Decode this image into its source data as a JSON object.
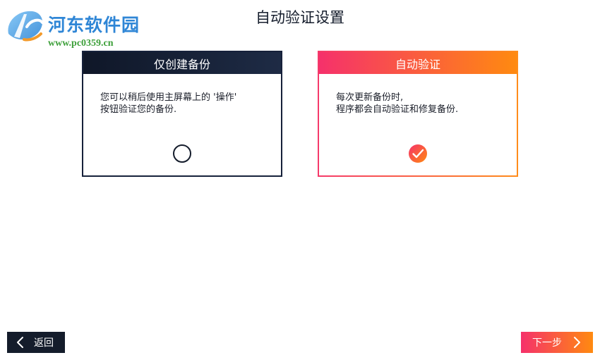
{
  "watermark": {
    "name": "河东软件园",
    "url": "www.pc0359.cn"
  },
  "page": {
    "title": "自动验证设置"
  },
  "options": [
    {
      "title": "仅创建备份",
      "description": [
        "您可以稍后使用主屏幕上的 '操作'",
        "按钮验证您的备份."
      ],
      "selected": false
    },
    {
      "title": "自动验证",
      "description": [
        "每次更新备份时,",
        "程序都会自动验证和修复备份."
      ],
      "selected": true
    }
  ],
  "nav": {
    "back_label": "返回",
    "next_label": "下一步"
  },
  "colors": {
    "dark": "#16213a",
    "accent_start": "#f5316b",
    "accent_end": "#ff8a10"
  },
  "icons": {
    "back": "chevron-left-icon",
    "next": "chevron-right-icon",
    "radio_off": "radio-unchecked-icon",
    "radio_on": "check-circle-icon"
  }
}
